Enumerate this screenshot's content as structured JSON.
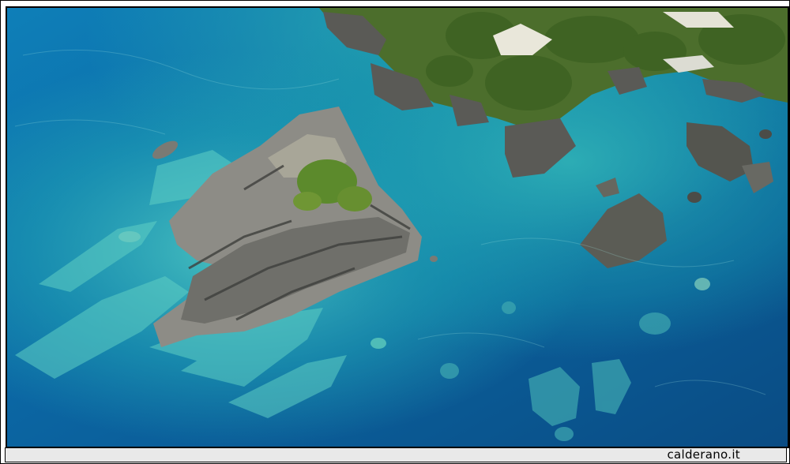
{
  "photo": {
    "watermark": "calderano.it"
  },
  "colors": {
    "deep_sea": "#0a4f86",
    "mid_sea": "#0c7ab0",
    "shallow_sea": "#1aa7b8",
    "reef_turquoise": "#49c5c0",
    "rock_grey": "#8a8a86",
    "rock_dark": "#3f403e",
    "vegetation": "#4f7a2a",
    "sand": "#e8e6d8"
  }
}
